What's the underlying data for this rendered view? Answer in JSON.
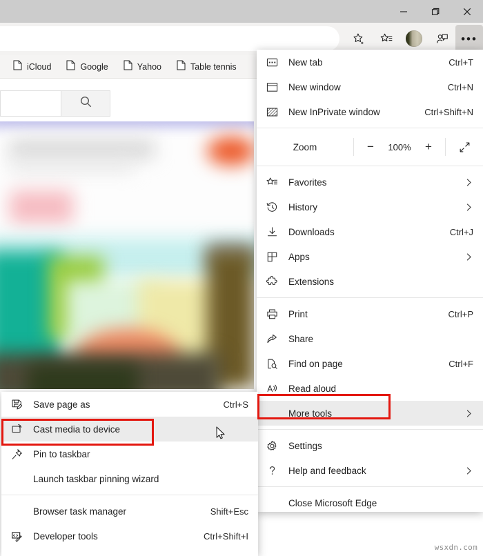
{
  "window": {
    "controls": [
      {
        "name": "minimize",
        "glyph": "minimize-icon"
      },
      {
        "name": "maximize",
        "glyph": "maximize-icon"
      },
      {
        "name": "close",
        "glyph": "close-icon"
      }
    ]
  },
  "toolbar": {
    "icons": [
      {
        "name": "add-favorite-icon",
        "title": "Add this page to favorites"
      },
      {
        "name": "favorites-icon",
        "title": "Favorites"
      },
      {
        "name": "profile-avatar",
        "title": "Profile"
      },
      {
        "name": "collections-icon",
        "title": "Collections"
      },
      {
        "name": "settings-and-more-icon",
        "title": "Settings and more",
        "label": "•••",
        "selected": true
      }
    ]
  },
  "bookmarks": {
    "items": [
      {
        "label": "iCloud",
        "icon": "page-icon"
      },
      {
        "label": "Google",
        "icon": "page-icon"
      },
      {
        "label": "Yahoo",
        "icon": "page-icon"
      },
      {
        "label": "Table tennis",
        "icon": "page-icon"
      }
    ]
  },
  "page": {
    "search_value": "",
    "search_placeholder": "",
    "search_button_icon": "search-icon"
  },
  "main_menu": {
    "items": [
      {
        "type": "item",
        "icon": "new-tab-icon",
        "label": "New tab",
        "accel": "Ctrl+T",
        "chevron": false
      },
      {
        "type": "item",
        "icon": "new-window-icon",
        "label": "New window",
        "accel": "Ctrl+N",
        "chevron": false
      },
      {
        "type": "item",
        "icon": "inprivate-icon",
        "label": "New InPrivate window",
        "accel": "Ctrl+Shift+N",
        "chevron": false
      },
      {
        "type": "separator"
      },
      {
        "type": "zoom",
        "label": "Zoom",
        "minus": "−",
        "value": "100%",
        "plus": "+",
        "fullscreen_icon": "fullscreen-icon"
      },
      {
        "type": "separator"
      },
      {
        "type": "item",
        "icon": "favorites-star-icon",
        "label": "Favorites",
        "accel": "",
        "chevron": true
      },
      {
        "type": "item",
        "icon": "history-icon",
        "label": "History",
        "accel": "",
        "chevron": true
      },
      {
        "type": "item",
        "icon": "downloads-icon",
        "label": "Downloads",
        "accel": "Ctrl+J",
        "chevron": false
      },
      {
        "type": "item",
        "icon": "apps-icon",
        "label": "Apps",
        "accel": "",
        "chevron": true
      },
      {
        "type": "item",
        "icon": "extensions-icon",
        "label": "Extensions",
        "accel": "",
        "chevron": false
      },
      {
        "type": "separator"
      },
      {
        "type": "item",
        "icon": "print-icon",
        "label": "Print",
        "accel": "Ctrl+P",
        "chevron": false
      },
      {
        "type": "item",
        "icon": "share-icon",
        "label": "Share",
        "accel": "",
        "chevron": false
      },
      {
        "type": "item",
        "icon": "find-on-page-icon",
        "label": "Find on page",
        "accel": "Ctrl+F",
        "chevron": false
      },
      {
        "type": "item",
        "icon": "read-aloud-icon",
        "label": "Read aloud",
        "accel": "",
        "chevron": false
      },
      {
        "type": "item",
        "icon": "",
        "label": "More tools",
        "accel": "",
        "chevron": true,
        "highlighted": true
      },
      {
        "type": "separator"
      },
      {
        "type": "item",
        "icon": "settings-gear-icon",
        "label": "Settings",
        "accel": "",
        "chevron": false
      },
      {
        "type": "item",
        "icon": "help-icon",
        "label": "Help and feedback",
        "accel": "",
        "chevron": true
      },
      {
        "type": "separator"
      },
      {
        "type": "item",
        "icon": "",
        "label": "Close Microsoft Edge",
        "accel": "",
        "chevron": false
      }
    ]
  },
  "sub_menu": {
    "items": [
      {
        "type": "item",
        "icon": "save-page-icon",
        "label": "Save page as",
        "accel": "Ctrl+S",
        "chevron": false
      },
      {
        "type": "item",
        "icon": "cast-icon",
        "label": "Cast media to device",
        "accel": "",
        "chevron": false,
        "highlighted": true
      },
      {
        "type": "item",
        "icon": "pin-icon",
        "label": "Pin to taskbar",
        "accel": "",
        "chevron": false
      },
      {
        "type": "item",
        "icon": "",
        "label": "Launch taskbar pinning wizard",
        "accel": "",
        "chevron": false
      },
      {
        "type": "separator"
      },
      {
        "type": "item",
        "icon": "",
        "label": "Browser task manager",
        "accel": "Shift+Esc",
        "chevron": false
      },
      {
        "type": "item",
        "icon": "devtools-icon",
        "label": "Developer tools",
        "accel": "Ctrl+Shift+I",
        "chevron": false
      }
    ]
  },
  "annotations": {
    "color": "#e3170f",
    "boxes": [
      {
        "name": "more-tools-highlight",
        "target": "More tools"
      },
      {
        "name": "cast-media-highlight",
        "target": "Cast media to device"
      }
    ]
  },
  "watermark": {
    "text": "wsxdn.com"
  }
}
